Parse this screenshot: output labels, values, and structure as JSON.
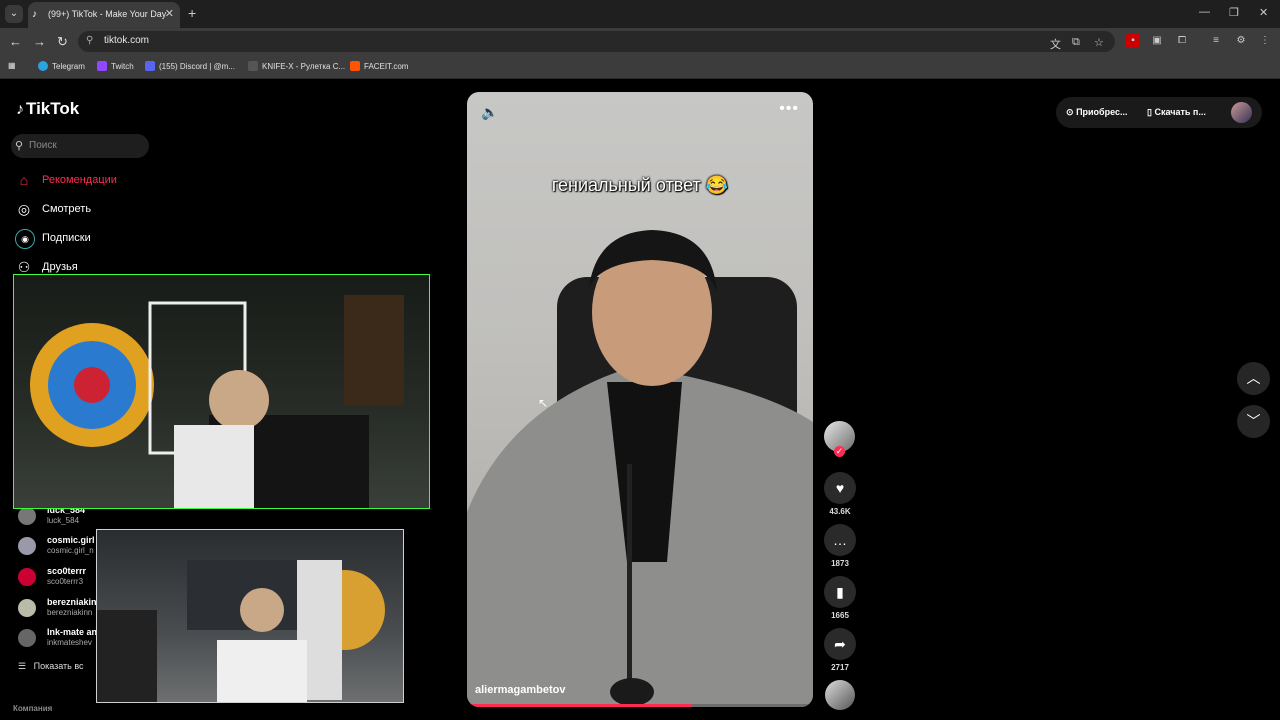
{
  "browser": {
    "tab_title": "(99+) TikTok - Make Your Day",
    "url": "tiktok.com",
    "bookmarks": [
      {
        "label": "Telegram",
        "color": "#2aa3de"
      },
      {
        "label": "Twitch",
        "color": "#9146ff"
      },
      {
        "label": "(155) Discord | @m...",
        "color": "#5865f2"
      },
      {
        "label": "KNIFE-X - Рулетка С...",
        "color": "#444"
      },
      {
        "label": "FACEIT.com",
        "color": "#ff5500"
      }
    ]
  },
  "tiktok": {
    "logo": "TikTok",
    "search_placeholder": "Поиск",
    "nav": [
      "Рекомендации",
      "Смотреть",
      "Подписки",
      "Друзья"
    ],
    "following": [
      {
        "name": "luck_584",
        "user": "luck_584"
      },
      {
        "name": "cosmic.girl",
        "user": "cosmic.girl_n"
      },
      {
        "name": "sco0terrr",
        "user": "sco0terrr3"
      },
      {
        "name": "berezniakin",
        "user": "berezniakinn"
      },
      {
        "name": "Ink-mate an",
        "user": "inkmateshev"
      }
    ],
    "show_more": "Показать вс",
    "company": "Компания",
    "video": {
      "caption": "гениальный ответ 😂",
      "author": "aliermagambetov",
      "progress": 0.65
    },
    "actions": {
      "likes": "43.6K",
      "comments": "1873",
      "saves": "1665",
      "shares": "2717"
    },
    "top": {
      "get_coins": "Приобрес...",
      "download": "Скачать п..."
    }
  },
  "colors": {
    "accent": "#fe2c55"
  }
}
